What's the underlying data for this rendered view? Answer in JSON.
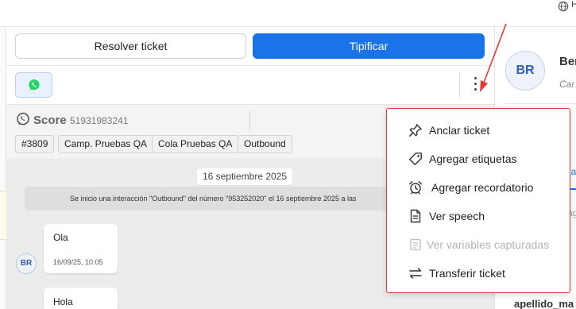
{
  "header": {
    "language_label": "H"
  },
  "actions": {
    "resolve_label": "Resolver ticket",
    "tipificar_label": "Tipificar"
  },
  "chat": {
    "score_label": "Score",
    "phone": "51931983241",
    "tags": [
      "#3809",
      "Camp. Pruebas QA",
      "Cola Pruebas QA",
      "Outbound"
    ],
    "date_pill": "16 septiembre 2025",
    "system_message": "Se inicio una interacción \"Outbound\" del número \"953252020\" el 16 septiembre 2025 a las",
    "avatar_initials": "BR",
    "messages": [
      {
        "text": "Ola",
        "time": "16/09/25, 10:05"
      },
      {
        "text": "Hola"
      }
    ]
  },
  "contact": {
    "initials": "BR",
    "name_fragment": "Ber",
    "subtitle_fragment": "Car",
    "tab_fragment": "na",
    "field_fragment": "ag",
    "bottom_fragment": "apellido_ma"
  },
  "menu": {
    "items": [
      {
        "label": "Anclar ticket",
        "icon": "pin-icon",
        "enabled": true
      },
      {
        "label": "Agregar etiquetas",
        "icon": "tag-icon",
        "enabled": true
      },
      {
        "label": "Agregar recordatorio",
        "icon": "alarm-clock-icon",
        "enabled": true
      },
      {
        "label": "Ver speech",
        "icon": "document-icon",
        "enabled": true
      },
      {
        "label": "Ver variables capturadas",
        "icon": "variables-icon",
        "enabled": false
      },
      {
        "label": "Transferir ticket",
        "icon": "transfer-icon",
        "enabled": true
      }
    ]
  },
  "colors": {
    "primary": "#1a73e8",
    "menu_border": "#e03b3b",
    "whatsapp": "#25d366",
    "annotation_arrow": "#e53935"
  }
}
